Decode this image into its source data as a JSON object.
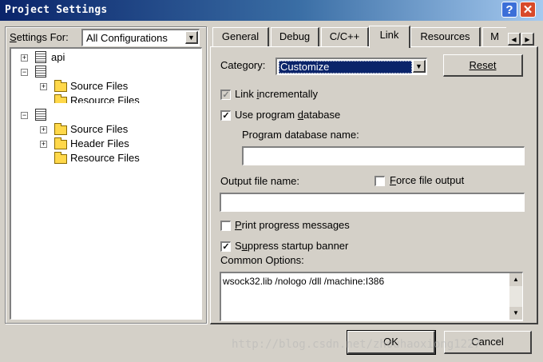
{
  "window": {
    "title": "Project Settings",
    "help_button": "?",
    "close_button": "✕"
  },
  "settings_for": {
    "label_pre": "",
    "label_underline": "S",
    "label_post": "ettings For:",
    "value": "All Configurations"
  },
  "tree": [
    {
      "label": "api",
      "expander": "+",
      "icon": "project-icon"
    },
    {
      "label": "",
      "expander": "−",
      "icon": "project-icon"
    },
    {
      "label": "Source Files",
      "expander": "+",
      "icon": "folder-icon"
    },
    {
      "label": "Resource Files",
      "expander": "",
      "icon": "folder-icon"
    },
    {
      "label": "",
      "expander": "−",
      "icon": "project-icon"
    },
    {
      "label": "Source Files",
      "expander": "+",
      "icon": "folder-icon"
    },
    {
      "label": "Header Files",
      "expander": "+",
      "icon": "folder-icon"
    },
    {
      "label": "Resource Files",
      "expander": "",
      "icon": "folder-icon"
    }
  ],
  "tabs": [
    {
      "label": "General",
      "active": false
    },
    {
      "label": "Debug",
      "active": false
    },
    {
      "label": "C/C++",
      "active": false
    },
    {
      "label": "Link",
      "active": true
    },
    {
      "label": "Resources",
      "active": false
    },
    {
      "label": "M",
      "active": false
    }
  ],
  "link": {
    "category_label": "Category:",
    "category_value": "Customize",
    "reset_label": "Reset",
    "link_incrementally": {
      "pre": "Link ",
      "u": "i",
      "post": "ncrementally",
      "checked": true,
      "disabled": true
    },
    "use_program_database": {
      "pre": "Use program ",
      "u": "d",
      "post": "atabase",
      "checked": true
    },
    "program_db_name_label": "Program database name:",
    "program_db_name_value": "",
    "output_file_name_label": "Output file name:",
    "output_file_name_value": "",
    "force_file_output": {
      "pre": "",
      "u": "F",
      "post": "orce file output",
      "checked": false
    },
    "print_progress": {
      "pre": "",
      "u": "P",
      "post": "rint progress messages",
      "checked": false
    },
    "suppress_banner": {
      "pre": "S",
      "u": "u",
      "post": "ppress startup banner",
      "checked": true
    },
    "common_options_label": "Common Options:",
    "common_options_value": "wsock32.lib /nologo /dll /machine:I386"
  },
  "buttons": {
    "ok": "OK",
    "cancel": "Cancel"
  },
  "watermark": "http://blog.csdn.net/zhouhaoxiong1227",
  "colors": {
    "dialog_bg": "#d4d0c8",
    "title_start": "#0a246a",
    "title_end": "#a6caf0",
    "selection": "#0a246a",
    "folder": "#ffd84a"
  }
}
